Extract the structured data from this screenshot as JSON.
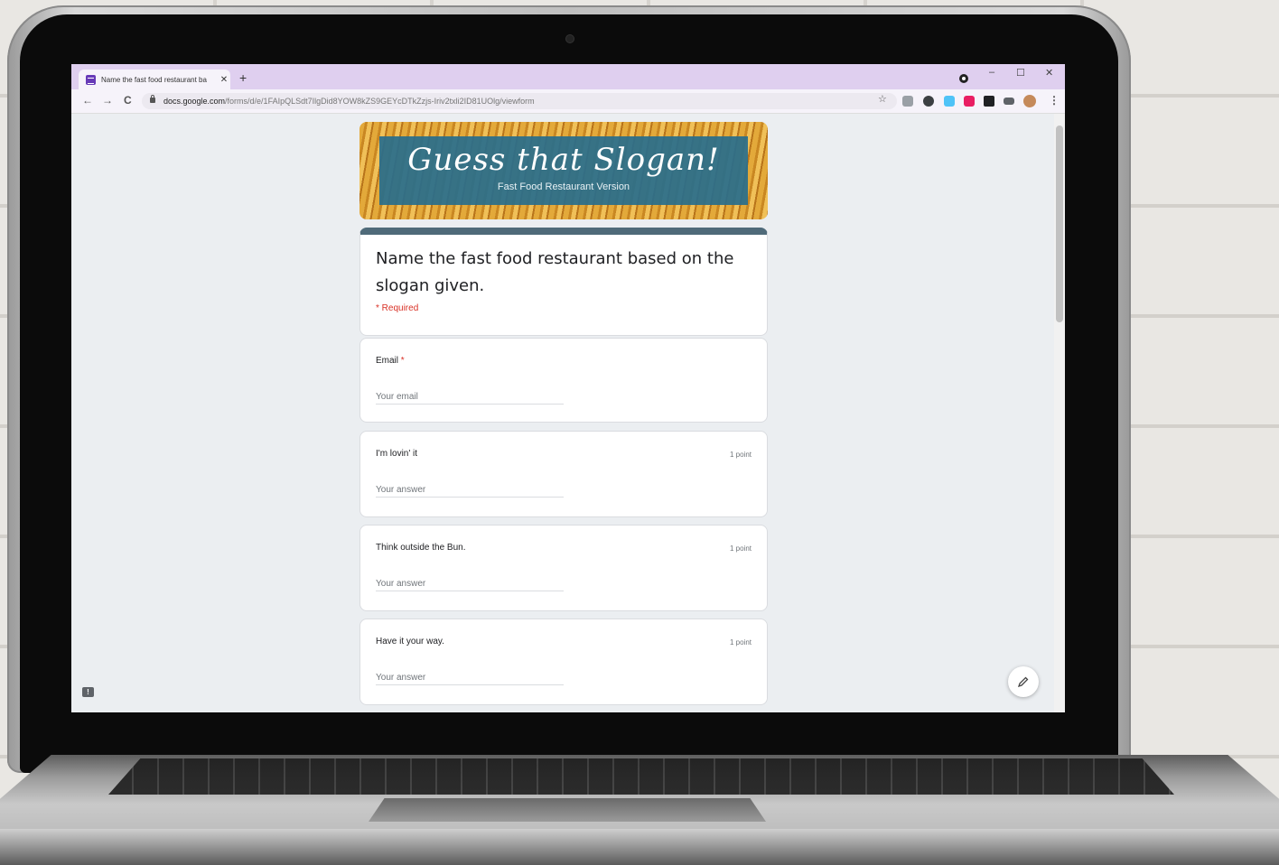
{
  "browser": {
    "tab_title": "Name the fast food restaurant ba",
    "tab_close": "✕",
    "new_tab": "+",
    "url_host": "docs.google.com",
    "url_path": "/forms/d/e/1FAIpQLSdt7IlgDid8YOW8kZS9GEYcDTkZzjs-Iriv2txli2ID81UOlg/viewform",
    "minimize": "–",
    "maximize": "☐",
    "close": "✕",
    "back": "←",
    "forward": "→",
    "reload": "C",
    "bookmark": "☆",
    "menu": "⋮"
  },
  "banner": {
    "title": "Guess that Slogan!",
    "subtitle": "Fast Food Restaurant Version"
  },
  "form": {
    "title": "Name the fast food restaurant based on the slogan given.",
    "required_note": "* Required"
  },
  "questions": [
    {
      "label": "Email",
      "required_mark": "*",
      "placeholder": "Your email",
      "points": ""
    },
    {
      "label": "I'm lovin' it",
      "required_mark": "",
      "placeholder": "Your answer",
      "points": "1 point"
    },
    {
      "label": "Think outside the Bun.",
      "required_mark": "",
      "placeholder": "Your answer",
      "points": "1 point"
    },
    {
      "label": "Have it your way.",
      "required_mark": "",
      "placeholder": "Your answer",
      "points": "1 point"
    }
  ],
  "colors": {
    "tabbar": "#dfcfef",
    "header_accent": "#4f6a79",
    "required": "#d93025",
    "page_bg": "#ebeef1"
  },
  "icons": {
    "edit": "pencil-icon",
    "feedback": "feedback-icon"
  }
}
